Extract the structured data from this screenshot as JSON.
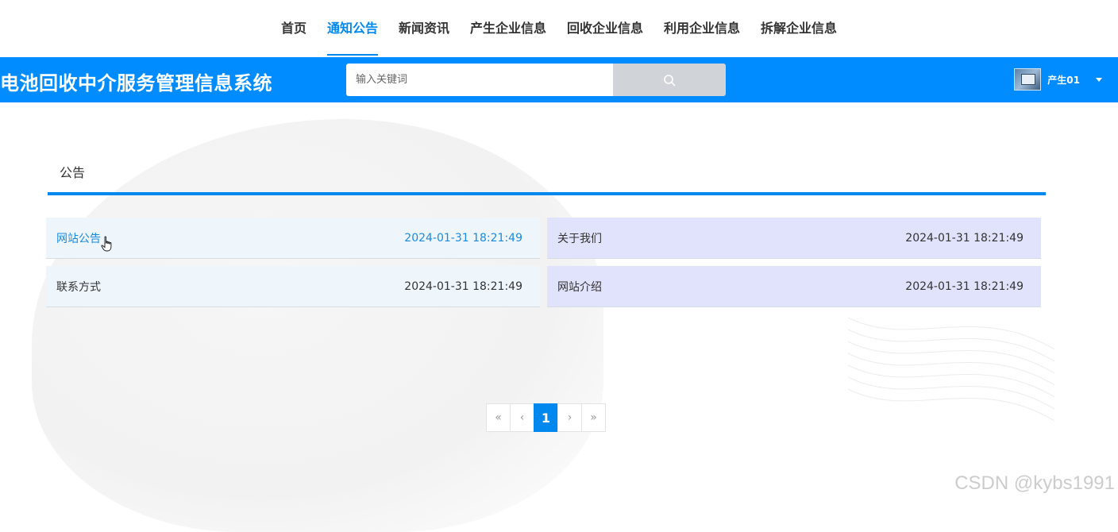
{
  "nav": {
    "items": [
      {
        "label": "首页",
        "active": false
      },
      {
        "label": "通知公告",
        "active": true
      },
      {
        "label": "新闻资讯",
        "active": false
      },
      {
        "label": "产生企业信息",
        "active": false
      },
      {
        "label": "回收企业信息",
        "active": false
      },
      {
        "label": "利用企业信息",
        "active": false
      },
      {
        "label": "拆解企业信息",
        "active": false
      }
    ]
  },
  "header": {
    "title": "电池回收中介服务管理信息系统",
    "search_placeholder": "输入关键词",
    "user_name": "产生01",
    "bar_color": "#008cff"
  },
  "section": {
    "title": "公告",
    "accent_color": "#0088ee"
  },
  "notices": [
    {
      "title": "网站公告",
      "date": "2024-01-31 18:21:49"
    },
    {
      "title": "关于我们",
      "date": "2024-01-31 18:21:49"
    },
    {
      "title": "联系方式",
      "date": "2024-01-31 18:21:49"
    },
    {
      "title": "网站介绍",
      "date": "2024-01-31 18:21:49"
    }
  ],
  "pagination": {
    "first": "«",
    "prev": "‹",
    "current": "1",
    "next": "›",
    "last": "»"
  },
  "watermark": "CSDN @kybs1991",
  "icons": {
    "search": "search-icon",
    "caret": "caret-down-icon",
    "cursor": "hand-pointer-icon"
  }
}
